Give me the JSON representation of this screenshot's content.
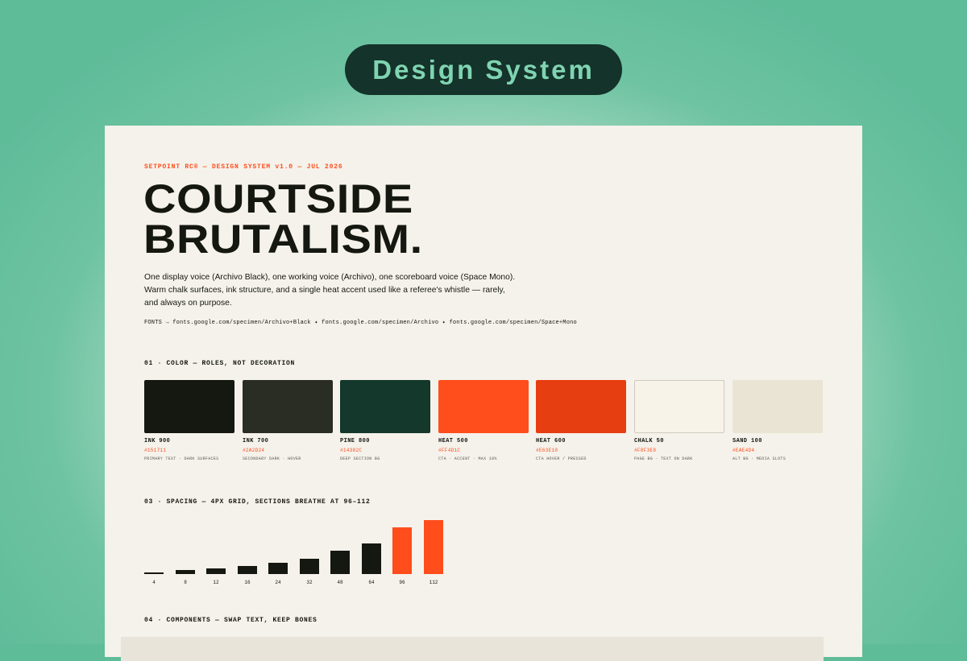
{
  "banner": {
    "title": "Design System"
  },
  "sheet": {
    "eyebrow": "SETPOINT RC® — DESIGN SYSTEM v1.0 — JUL 2026",
    "headline": [
      "COURTSIDE",
      "BRUTALISM."
    ],
    "lede": "One display voice (Archivo Black), one working voice (Archivo), one scoreboard voice (Space Mono). Warm chalk surfaces, ink structure, and a single heat accent used like a referee's whistle — rarely, and always on purpose.",
    "fonts": "FONTS → fonts.google.com/specimen/Archivo+Black ✦ fonts.google.com/specimen/Archivo ✦ fonts.google.com/specimen/Space+Mono"
  },
  "sections": {
    "color": "01 · COLOR — ROLES, NOT DECORATION",
    "spacing": "03 · SPACING — 4PX GRID, SECTIONS BREATHE AT 96–112",
    "components": "04 · COMPONENTS — SWAP TEXT, KEEP BONES"
  },
  "swatches": [
    {
      "name": "INK 900",
      "hex": "#151711",
      "role": "PRIMARY TEXT · DARK SURFACES",
      "color": "#151711"
    },
    {
      "name": "INK 700",
      "hex": "#2A2D24",
      "role": "SECONDARY DARK · HOVER",
      "color": "#2A2D24"
    },
    {
      "name": "PINE 800",
      "hex": "#14382C",
      "role": "DEEP SECTION BG",
      "color": "#14382C"
    },
    {
      "name": "HEAT 500",
      "hex": "#FF4D1C",
      "role": "CTA · ACCENT · MAX 10%",
      "color": "#FF4D1C"
    },
    {
      "name": "HEAT 600",
      "hex": "#E63E10",
      "role": "CTA HOVER / PRESSED",
      "color": "#E63E10"
    },
    {
      "name": "CHALK 50",
      "hex": "#F8F3E8",
      "role": "PAGE BG · TEXT ON DARK",
      "color": "#F8F3E8"
    },
    {
      "name": "SAND 100",
      "hex": "#EAE4D4",
      "role": "ALT BG · MEDIA SLOTS",
      "color": "#EAE4D4"
    }
  ],
  "spacing_scale": {
    "steps": [
      4,
      8,
      12,
      16,
      24,
      32,
      48,
      64,
      96,
      112
    ],
    "labels": [
      "4",
      "8",
      "12",
      "16",
      "24",
      "32",
      "48",
      "64",
      "96",
      "112"
    ],
    "bar_color": "#151711",
    "accent_color": "#FF4D1C",
    "accent_steps": [
      96,
      112
    ]
  }
}
